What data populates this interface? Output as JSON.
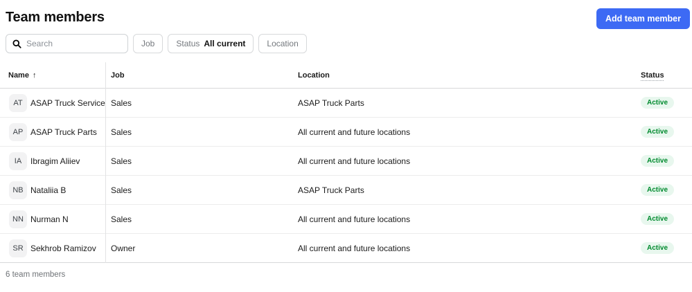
{
  "page": {
    "title": "Team members",
    "add_button_label": "Add team member",
    "footer": "6 team members"
  },
  "search": {
    "placeholder": "Search"
  },
  "filters": [
    {
      "label": "Job",
      "value": ""
    },
    {
      "label": "Status",
      "value": "All current"
    },
    {
      "label": "Location",
      "value": ""
    }
  ],
  "table": {
    "columns": [
      "Name",
      "Job",
      "Location",
      "Status"
    ],
    "sort": {
      "column": "Name",
      "direction": "ascending",
      "icon": "up-arrow"
    },
    "rows": [
      {
        "initials": "AT",
        "name": "ASAP Truck Service",
        "job": "Sales",
        "location": "ASAP Truck Parts",
        "status": "Active"
      },
      {
        "initials": "AP",
        "name": "ASAP Truck Parts",
        "job": "Sales",
        "location": "All current and future locations",
        "status": "Active"
      },
      {
        "initials": "IA",
        "name": "Ibragim Aliiev",
        "job": "Sales",
        "location": "All current and future locations",
        "status": "Active"
      },
      {
        "initials": "NB",
        "name": "Nataliia B",
        "job": "Sales",
        "location": "ASAP Truck Parts",
        "status": "Active"
      },
      {
        "initials": "NN",
        "name": "Nurman N",
        "job": "Sales",
        "location": "All current and future locations",
        "status": "Active"
      },
      {
        "initials": "SR",
        "name": "Sekhrob Ramizov",
        "job": "Owner",
        "location": "All current and future locations",
        "status": "Active"
      }
    ]
  },
  "colors": {
    "accent": "#3d6af4",
    "badge_bg": "#e8f7ee",
    "badge_fg": "#008a2e"
  }
}
